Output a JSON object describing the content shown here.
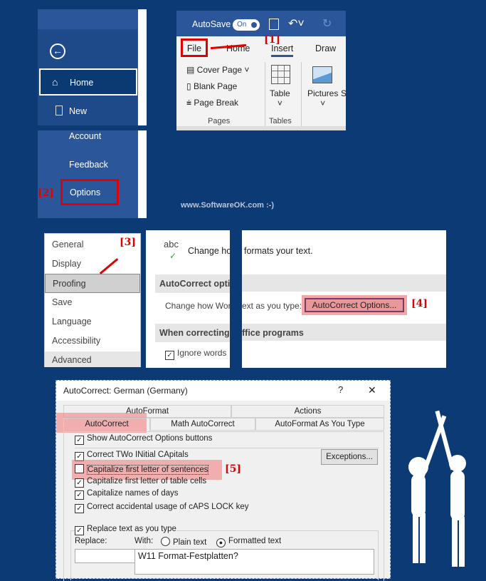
{
  "file_menu": {
    "items": [
      "Home",
      "New",
      "Account",
      "Feedback",
      "Options"
    ],
    "back_icon": "back-arrow-icon"
  },
  "ribbon": {
    "autosave": "AutoSave",
    "toggle": "On",
    "tabs": [
      "File",
      "Home",
      "Insert",
      "Draw"
    ],
    "active_tab": "Insert",
    "pages_items": [
      "Cover Page",
      "Blank Page",
      "Page Break"
    ],
    "pages_group": "Pages",
    "table": "Table",
    "tables_group": "Tables",
    "pictures": "Pictures",
    "cut": "S"
  },
  "watermark": "www.SoftwareOK.com :-)",
  "options_list": {
    "items": [
      "General",
      "Display",
      "Proofing",
      "Save",
      "Language",
      "Accessibility",
      "Advanced"
    ],
    "selected": "Proofing"
  },
  "proofing": {
    "abc": "abc",
    "heading": "Change how formats your text.",
    "autocorrect_section": "AutoCorrect optio",
    "change_label": "Change how Wor",
    "correcting_section": "When correcting s",
    "ignore": "Ignore words"
  },
  "proofing_right": {
    "heading": "formats your text.",
    "change_label": "ext as you type:",
    "button": "AutoCorrect Options...",
    "correcting_section": "ffice programs"
  },
  "steps": [
    "[1]",
    "[2]",
    "[3]",
    "[4]",
    "[5]"
  ],
  "dialog": {
    "title": "AutoCorrect: German (Germany)",
    "help": "?",
    "close": "✕",
    "tabs_top": [
      "AutoFormat",
      "Actions"
    ],
    "tabs_bottom": [
      "AutoCorrect",
      "Math AutoCorrect",
      "AutoFormat As You Type"
    ],
    "active_tab": "AutoCorrect",
    "show_buttons": {
      "label": "Show AutoCorrect Options buttons",
      "checked": true
    },
    "options": [
      {
        "label": "Correct TWo INitial CApitals",
        "checked": true
      },
      {
        "label": "Capitalize first letter of sentences",
        "checked": false
      },
      {
        "label": "Capitalize first letter of table cells",
        "checked": true
      },
      {
        "label": "Capitalize names of days",
        "checked": true
      },
      {
        "label": "Correct accidental usage of cAPS LOCK key",
        "checked": true
      }
    ],
    "exceptions": "Exceptions...",
    "replace_text": {
      "label": "Replace text as you type",
      "checked": true
    },
    "replace_label": "Replace:",
    "with_label": "With:",
    "plain": "Plain text",
    "formatted": "Formatted text",
    "format_selected": "Formatted text",
    "replace_value": "",
    "with_value": "W11 Format-Festplatten?"
  }
}
